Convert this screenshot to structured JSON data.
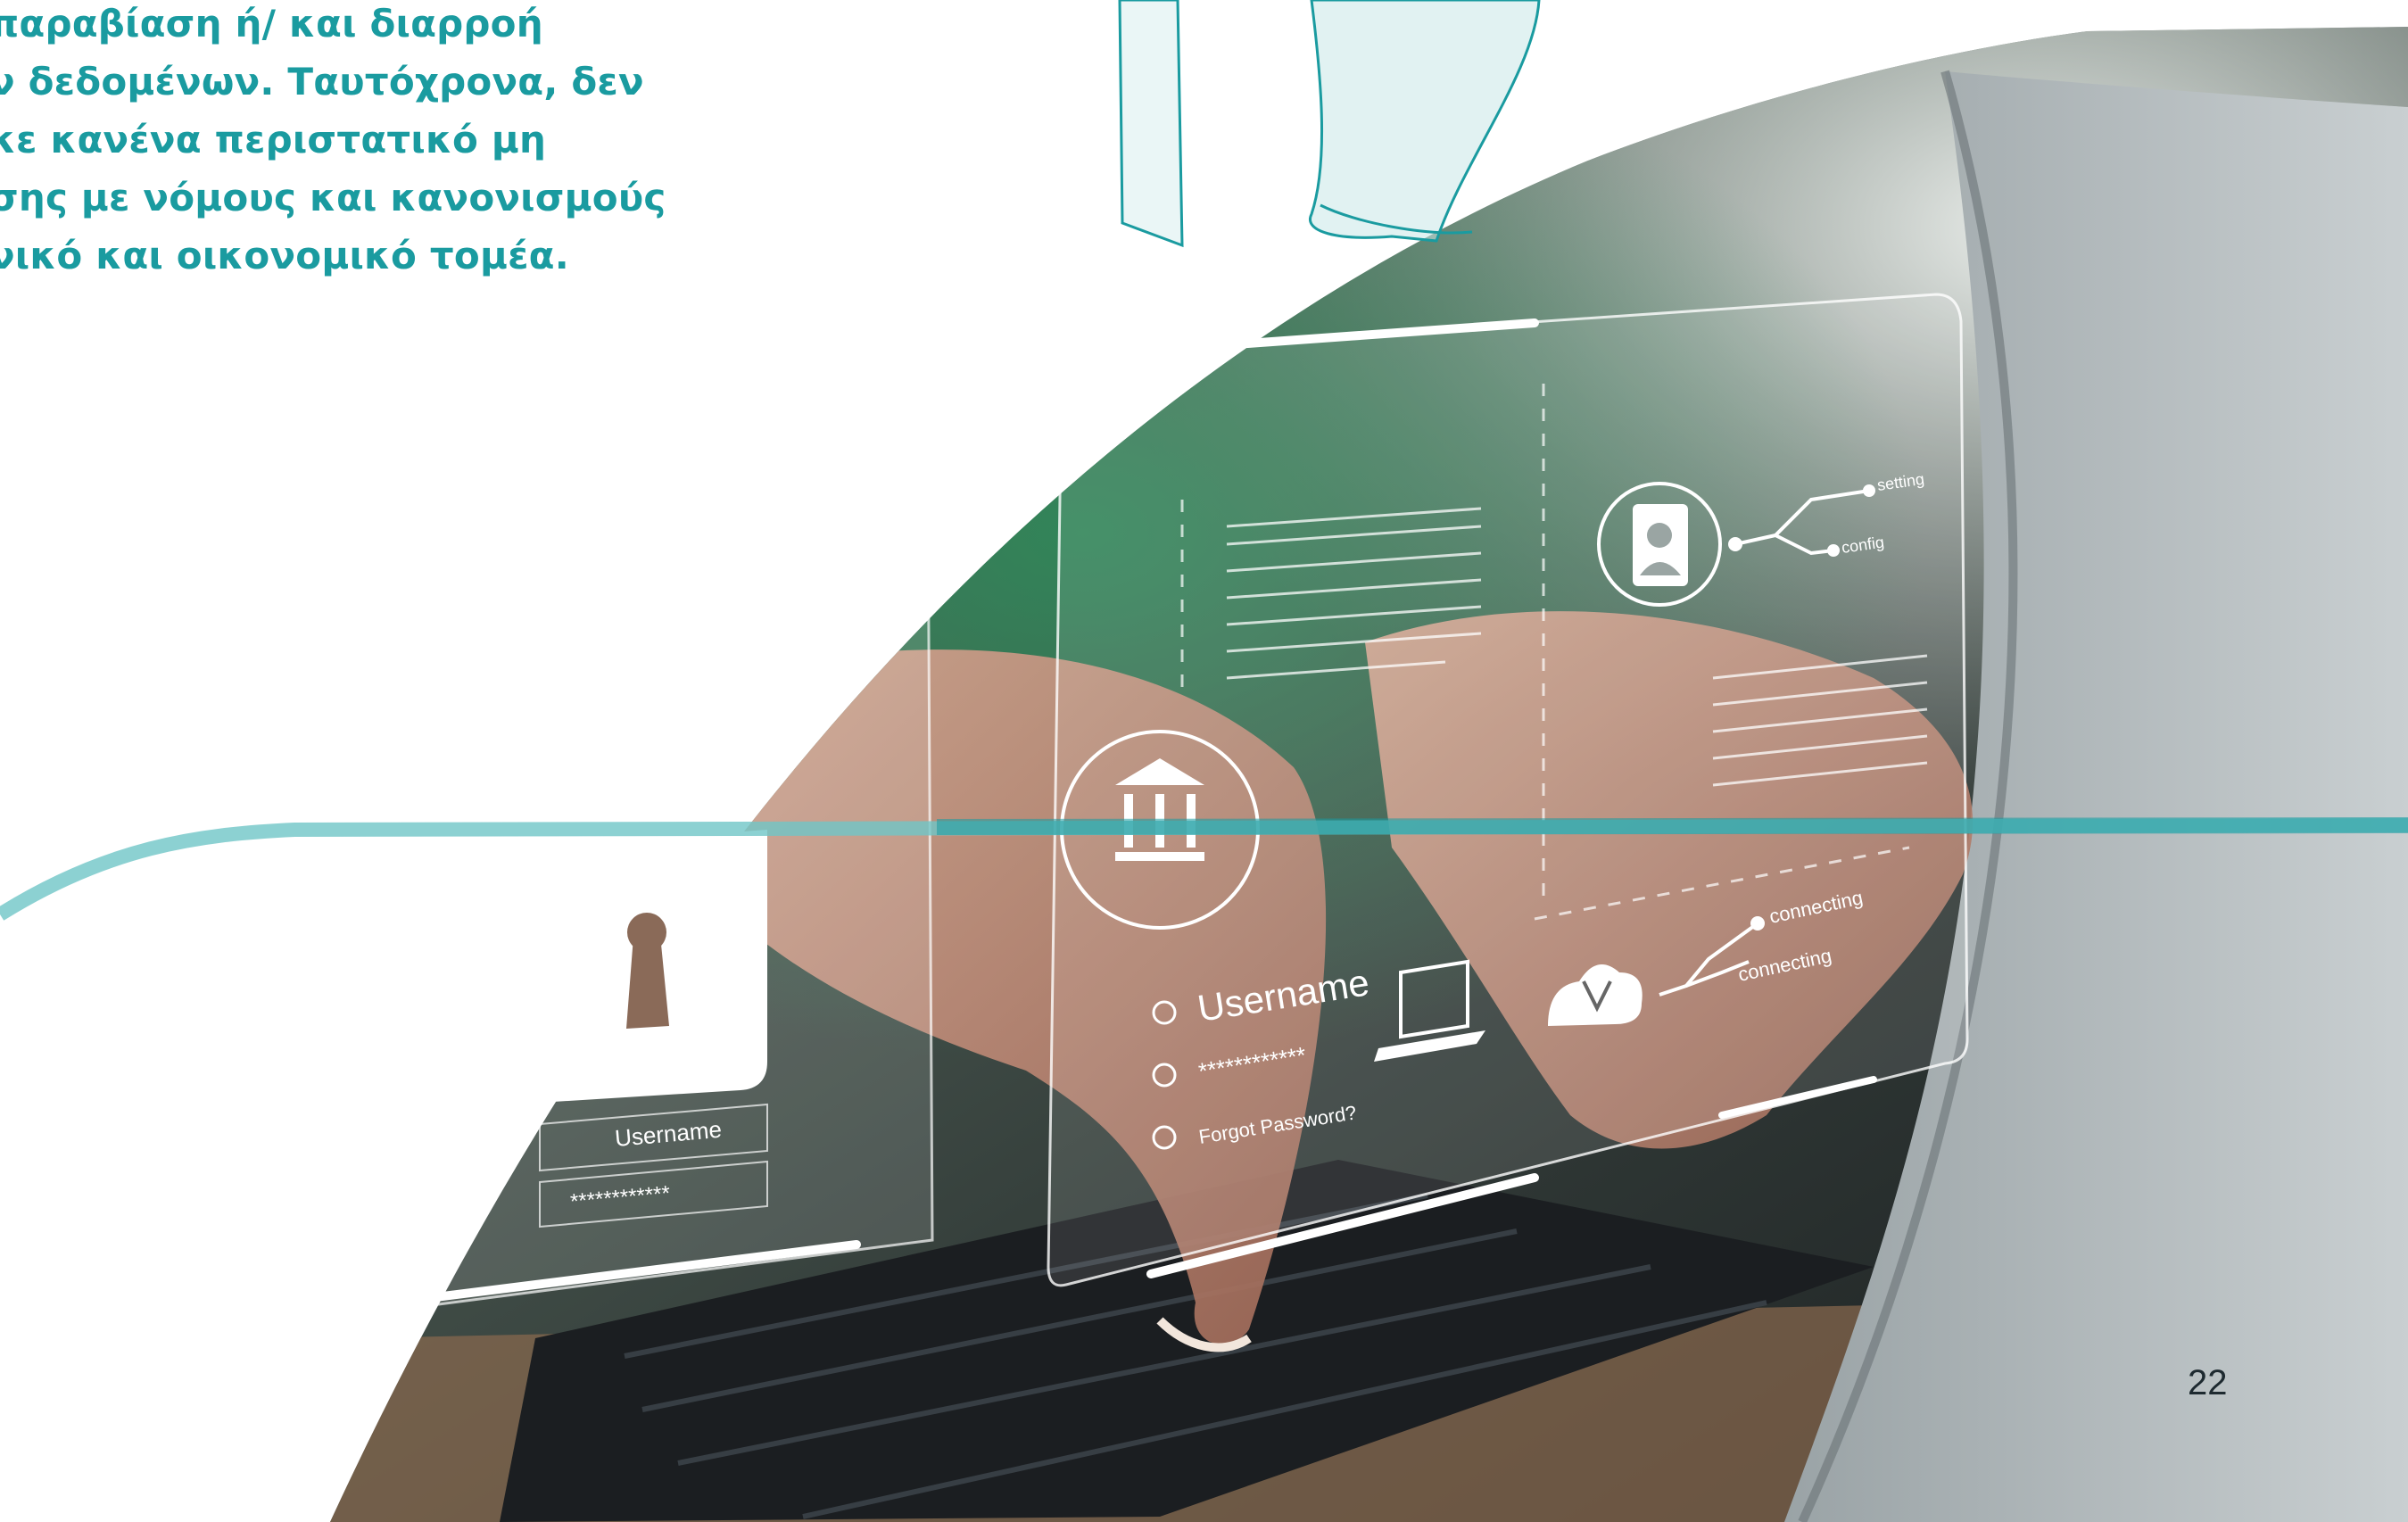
{
  "colors": {
    "accent": "#1a9ba0",
    "wave": "#6fc5c7",
    "page_number": "#1e2a30"
  },
  "intro_lines": [
    "παραβίαση ή/ και διαρροή",
    "ν δεδομένων. Ταυτόχρονα, δεν",
    "κε κανένα περιστατικό μη",
    "σης με νόμους και κανονισμούς",
    "νικό και οικονομικό τομέα."
  ],
  "photo": {
    "lock_panel": {
      "icon": "padlock-icon",
      "username_label": "Username",
      "password_mask": "************"
    },
    "login_panel": {
      "bank_icon": "bank-icon",
      "username_label": "Username",
      "password_mask": "************",
      "forgot_password": "Forgot Password?",
      "laptop_icon": "laptop-icon",
      "user_icon": "user-profile-icon",
      "cloud_icon": "cloud-icon",
      "setting_label": "setting",
      "config_label": "config",
      "connecting_label_1": "connecting",
      "connecting_label_2": "connecting"
    }
  },
  "page_number": "22"
}
